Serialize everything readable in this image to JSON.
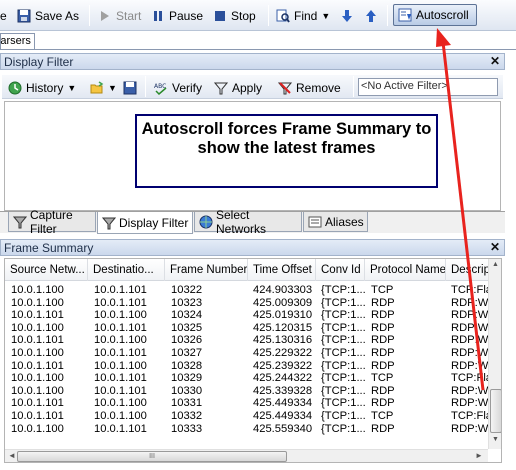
{
  "toolbar": {
    "save_label": "e",
    "save_as_label": "Save As",
    "start_label": "Start",
    "pause_label": "Pause",
    "stop_label": "Stop",
    "find_label": "Find",
    "autoscroll_label": "Autoscroll"
  },
  "tabs": {
    "parsers": "Parsers"
  },
  "display_filter": {
    "title": "Display Filter",
    "history_label": "History",
    "verify_label": "Verify",
    "apply_label": "Apply",
    "remove_label": "Remove",
    "active_filter": "<No Active Filter>"
  },
  "callout": {
    "text": "Autoscroll forces Frame Summary to show the latest frames"
  },
  "bottom_tabs": {
    "capture_filter": "Capture Filter",
    "display_filter": "Display Filter",
    "select_networks": "Select Networks",
    "aliases": "Aliases"
  },
  "frame_summary": {
    "title": "Frame Summary",
    "columns": [
      "Source Netw...",
      "Destinatio...",
      "Frame Number",
      "Time Offset",
      "Conv Id",
      "Protocol Name",
      "Descrip"
    ],
    "rows": [
      [
        "10.0.1.100",
        "10.0.1.101",
        "10322",
        "424.903303",
        "{TCP:1...",
        "TCP",
        "TCP:Fla"
      ],
      [
        "10.0.1.100",
        "10.0.1.101",
        "10323",
        "425.009309",
        "{TCP:1...",
        "RDP",
        "RDP:Wi"
      ],
      [
        "10.0.1.101",
        "10.0.1.100",
        "10324",
        "425.019310",
        "{TCP:1...",
        "RDP",
        "RDP:Wi"
      ],
      [
        "10.0.1.100",
        "10.0.1.101",
        "10325",
        "425.120315",
        "{TCP:1...",
        "RDP",
        "RDP:Wi"
      ],
      [
        "10.0.1.101",
        "10.0.1.100",
        "10326",
        "425.130316",
        "{TCP:1...",
        "RDP",
        "RDP:Wi"
      ],
      [
        "10.0.1.100",
        "10.0.1.101",
        "10327",
        "425.229322",
        "{TCP:1...",
        "RDP",
        "RDP:Wi"
      ],
      [
        "10.0.1.101",
        "10.0.1.100",
        "10328",
        "425.239322",
        "{TCP:1...",
        "RDP",
        "RDP:Wi"
      ],
      [
        "10.0.1.100",
        "10.0.1.101",
        "10329",
        "425.244322",
        "{TCP:1...",
        "TCP",
        "TCP:Fla"
      ],
      [
        "10.0.1.100",
        "10.0.1.101",
        "10330",
        "425.339328",
        "{TCP:1...",
        "RDP",
        "RDP:Wi"
      ],
      [
        "10.0.1.101",
        "10.0.1.100",
        "10331",
        "425.449334",
        "{TCP:1...",
        "RDP",
        "RDP:Wi"
      ],
      [
        "10.0.1.101",
        "10.0.1.100",
        "10332",
        "425.449334",
        "{TCP:1...",
        "TCP",
        "TCP:Fla"
      ],
      [
        "10.0.1.100",
        "10.0.1.101",
        "10333",
        "425.559340",
        "{TCP:1...",
        "RDP",
        "RDP:Wi"
      ]
    ]
  },
  "scrollbars": {
    "up": "▲",
    "down": "▼",
    "left": "◄",
    "right": "►",
    "grip": "III"
  },
  "colors": {
    "accent_arrow": "#e8231e",
    "callout_border": "#000070"
  }
}
